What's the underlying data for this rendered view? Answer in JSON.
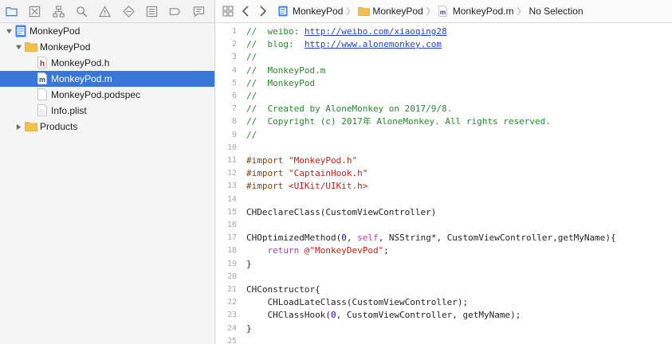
{
  "navigator": {
    "toolbar_icons": [
      "folder-icon",
      "x-box-icon",
      "hierarchy-icon",
      "search-icon",
      "warning-icon",
      "test-diamond-icon",
      "debug-list-icon",
      "breakpoint-icon",
      "report-icon"
    ],
    "tree": [
      {
        "label": "MonkeyPod",
        "kind": "project",
        "depth": 0,
        "expanded": true
      },
      {
        "label": "MonkeyPod",
        "kind": "folder",
        "depth": 1,
        "expanded": true
      },
      {
        "label": "MonkeyPod.h",
        "kind": "h-file",
        "depth": 2
      },
      {
        "label": "MonkeyPod.m",
        "kind": "m-file",
        "depth": 2,
        "selected": true
      },
      {
        "label": "MonkeyPod.podspec",
        "kind": "plain-file",
        "depth": 2
      },
      {
        "label": "Info.plist",
        "kind": "plain-file",
        "depth": 2
      },
      {
        "label": "Products",
        "kind": "folder",
        "depth": 1,
        "expanded": false
      }
    ]
  },
  "jumpbar": {
    "crumbs": [
      "MonkeyPod",
      "MonkeyPod",
      "MonkeyPod.m",
      "No Selection"
    ]
  },
  "code": {
    "lines": [
      [
        {
          "t": "//  weibo: ",
          "c": "comment"
        },
        {
          "t": "http://weibo.com/xiaoqing28",
          "c": "url"
        }
      ],
      [
        {
          "t": "//  blog:  ",
          "c": "comment"
        },
        {
          "t": "http://www.alonemonkey.com",
          "c": "url"
        }
      ],
      [
        {
          "t": "//",
          "c": "comment"
        }
      ],
      [
        {
          "t": "//  MonkeyPod.m",
          "c": "comment"
        }
      ],
      [
        {
          "t": "//  MonkeyPod",
          "c": "comment"
        }
      ],
      [
        {
          "t": "//",
          "c": "comment"
        }
      ],
      [
        {
          "t": "//  Created by AloneMonkey on 2017/9/8.",
          "c": "comment"
        }
      ],
      [
        {
          "t": "//  Copyright (c) 2017年 AloneMonkey. All rights reserved.",
          "c": "comment"
        }
      ],
      [
        {
          "t": "//",
          "c": "comment"
        }
      ],
      [],
      [
        {
          "t": "#import ",
          "c": "pp"
        },
        {
          "t": "\"MonkeyPod.h\"",
          "c": "str"
        }
      ],
      [
        {
          "t": "#import ",
          "c": "pp"
        },
        {
          "t": "\"CaptainHook.h\"",
          "c": "str"
        }
      ],
      [
        {
          "t": "#import ",
          "c": "pp"
        },
        {
          "t": "<UIKit/UIKit.h>",
          "c": "str"
        }
      ],
      [],
      [
        {
          "t": "CHDeclareClass(CustomViewController)",
          "c": "plain"
        }
      ],
      [],
      [
        {
          "t": "CHOptimizedMethod(",
          "c": "plain"
        },
        {
          "t": "0",
          "c": "num"
        },
        {
          "t": ", ",
          "c": "plain"
        },
        {
          "t": "self",
          "c": "kw"
        },
        {
          "t": ", NSString*, CustomViewController,getMyName){",
          "c": "plain"
        }
      ],
      [
        {
          "t": "    ",
          "c": "plain"
        },
        {
          "t": "return",
          "c": "kw"
        },
        {
          "t": " ",
          "c": "plain"
        },
        {
          "t": "@\"MonkeyDevPod\"",
          "c": "str"
        },
        {
          "t": ";",
          "c": "plain"
        }
      ],
      [
        {
          "t": "}",
          "c": "plain"
        }
      ],
      [],
      [
        {
          "t": "CHConstructor{",
          "c": "plain"
        }
      ],
      [
        {
          "t": "    CHLoadLateClass(CustomViewController);",
          "c": "plain"
        }
      ],
      [
        {
          "t": "    CHClassHook(",
          "c": "plain"
        },
        {
          "t": "0",
          "c": "num"
        },
        {
          "t": ", CustomViewController, getMyName);",
          "c": "plain"
        }
      ],
      [
        {
          "t": "}",
          "c": "plain"
        }
      ],
      []
    ]
  },
  "colors": {
    "selection": "#3876d8",
    "comment": "#24862b",
    "url": "#1c3fd6",
    "string": "#c41a16",
    "keyword": "#ad3da4",
    "number": "#1c00cf",
    "preprocessor": "#7a3f19"
  }
}
